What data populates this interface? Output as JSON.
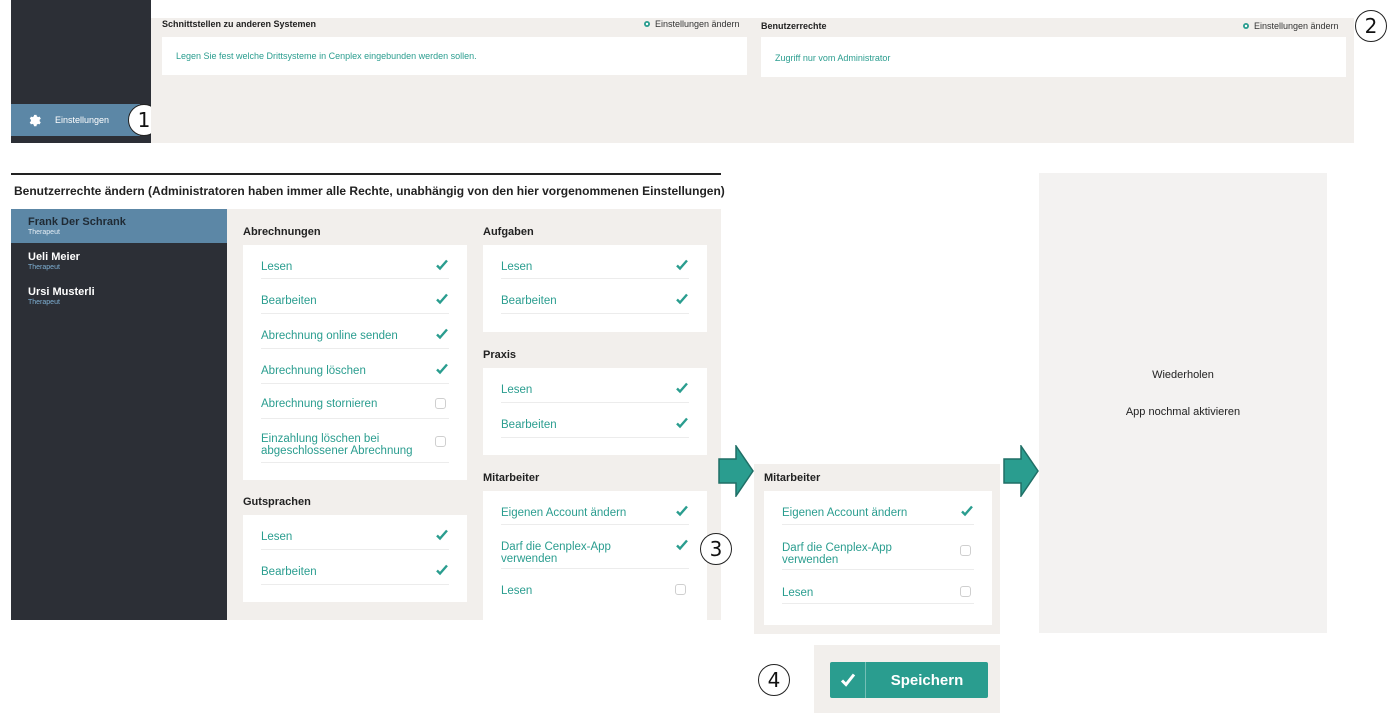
{
  "colors": {
    "accent": "#2a9d8f",
    "dark": "#2c2f36",
    "active_nav": "#5c87a6",
    "beige": "#f2efec"
  },
  "sidebar": {
    "settings_label": "Einstellungen",
    "settings_icon": "gear-icon"
  },
  "interfaces_panel": {
    "title": "Schnittstellen zu anderen Systemen",
    "action": "Einstellungen ändern",
    "description": "Legen Sie fest welche Drittsysteme in Cenplex eingebunden werden sollen."
  },
  "rights_panel": {
    "title": "Benutzerrechte",
    "action": "Einstellungen ändern",
    "description": "Zugriff nur vom Administrator"
  },
  "callouts": [
    "1",
    "2",
    "3",
    "4"
  ],
  "main": {
    "heading": "Benutzerrechte ändern (Administratoren haben immer alle Rechte, unabhängig von den hier vorgenommenen Einstellungen)",
    "users": [
      {
        "name": "Frank Der Schrank",
        "role": "Therapeut",
        "active": true
      },
      {
        "name": "Ueli  Meier",
        "role": "Therapeut",
        "active": false
      },
      {
        "name": "Ursi Musterli",
        "role": "Therapeut",
        "active": false
      }
    ],
    "groups": {
      "abrechnungen": {
        "title": "Abrechnungen",
        "items": [
          {
            "label": "Lesen",
            "checked": true
          },
          {
            "label": "Bearbeiten",
            "checked": true
          },
          {
            "label": "Abrechnung online senden",
            "checked": true
          },
          {
            "label": "Abrechnung löschen",
            "checked": true
          },
          {
            "label": "Abrechnung stornieren",
            "checked": false
          },
          {
            "label_line1": "Einzahlung löschen bei",
            "label_line2": "abgeschlossener Abrechnung",
            "checked": false
          }
        ]
      },
      "gutsprachen": {
        "title": "Gutsprachen",
        "items": [
          {
            "label": "Lesen",
            "checked": true
          },
          {
            "label": "Bearbeiten",
            "checked": true
          }
        ]
      },
      "aufgaben": {
        "title": "Aufgaben",
        "items": [
          {
            "label": "Lesen",
            "checked": true
          },
          {
            "label": "Bearbeiten",
            "checked": true
          }
        ]
      },
      "praxis": {
        "title": "Praxis",
        "items": [
          {
            "label": "Lesen",
            "checked": true
          },
          {
            "label": "Bearbeiten",
            "checked": true
          }
        ]
      },
      "mitarbeiter": {
        "title": "Mitarbeiter",
        "items": [
          {
            "label": "Eigenen Account ändern",
            "checked": true
          },
          {
            "label_line1": "Darf die Cenplex-App",
            "label_line2": "verwenden",
            "checked": true
          },
          {
            "label": "Lesen",
            "checked": false
          }
        ]
      }
    }
  },
  "zoom_panel": {
    "title": "Mitarbeiter",
    "items": [
      {
        "label": "Eigenen Account ändern",
        "checked": true
      },
      {
        "label_line1": "Darf die Cenplex-App",
        "label_line2": "verwenden",
        "checked": false
      },
      {
        "label": "Lesen",
        "checked": false
      }
    ]
  },
  "right_panel": {
    "retry": "Wiederholen",
    "reactivate": "App nochmal aktivieren"
  },
  "save_button": {
    "label": "Speichern"
  }
}
